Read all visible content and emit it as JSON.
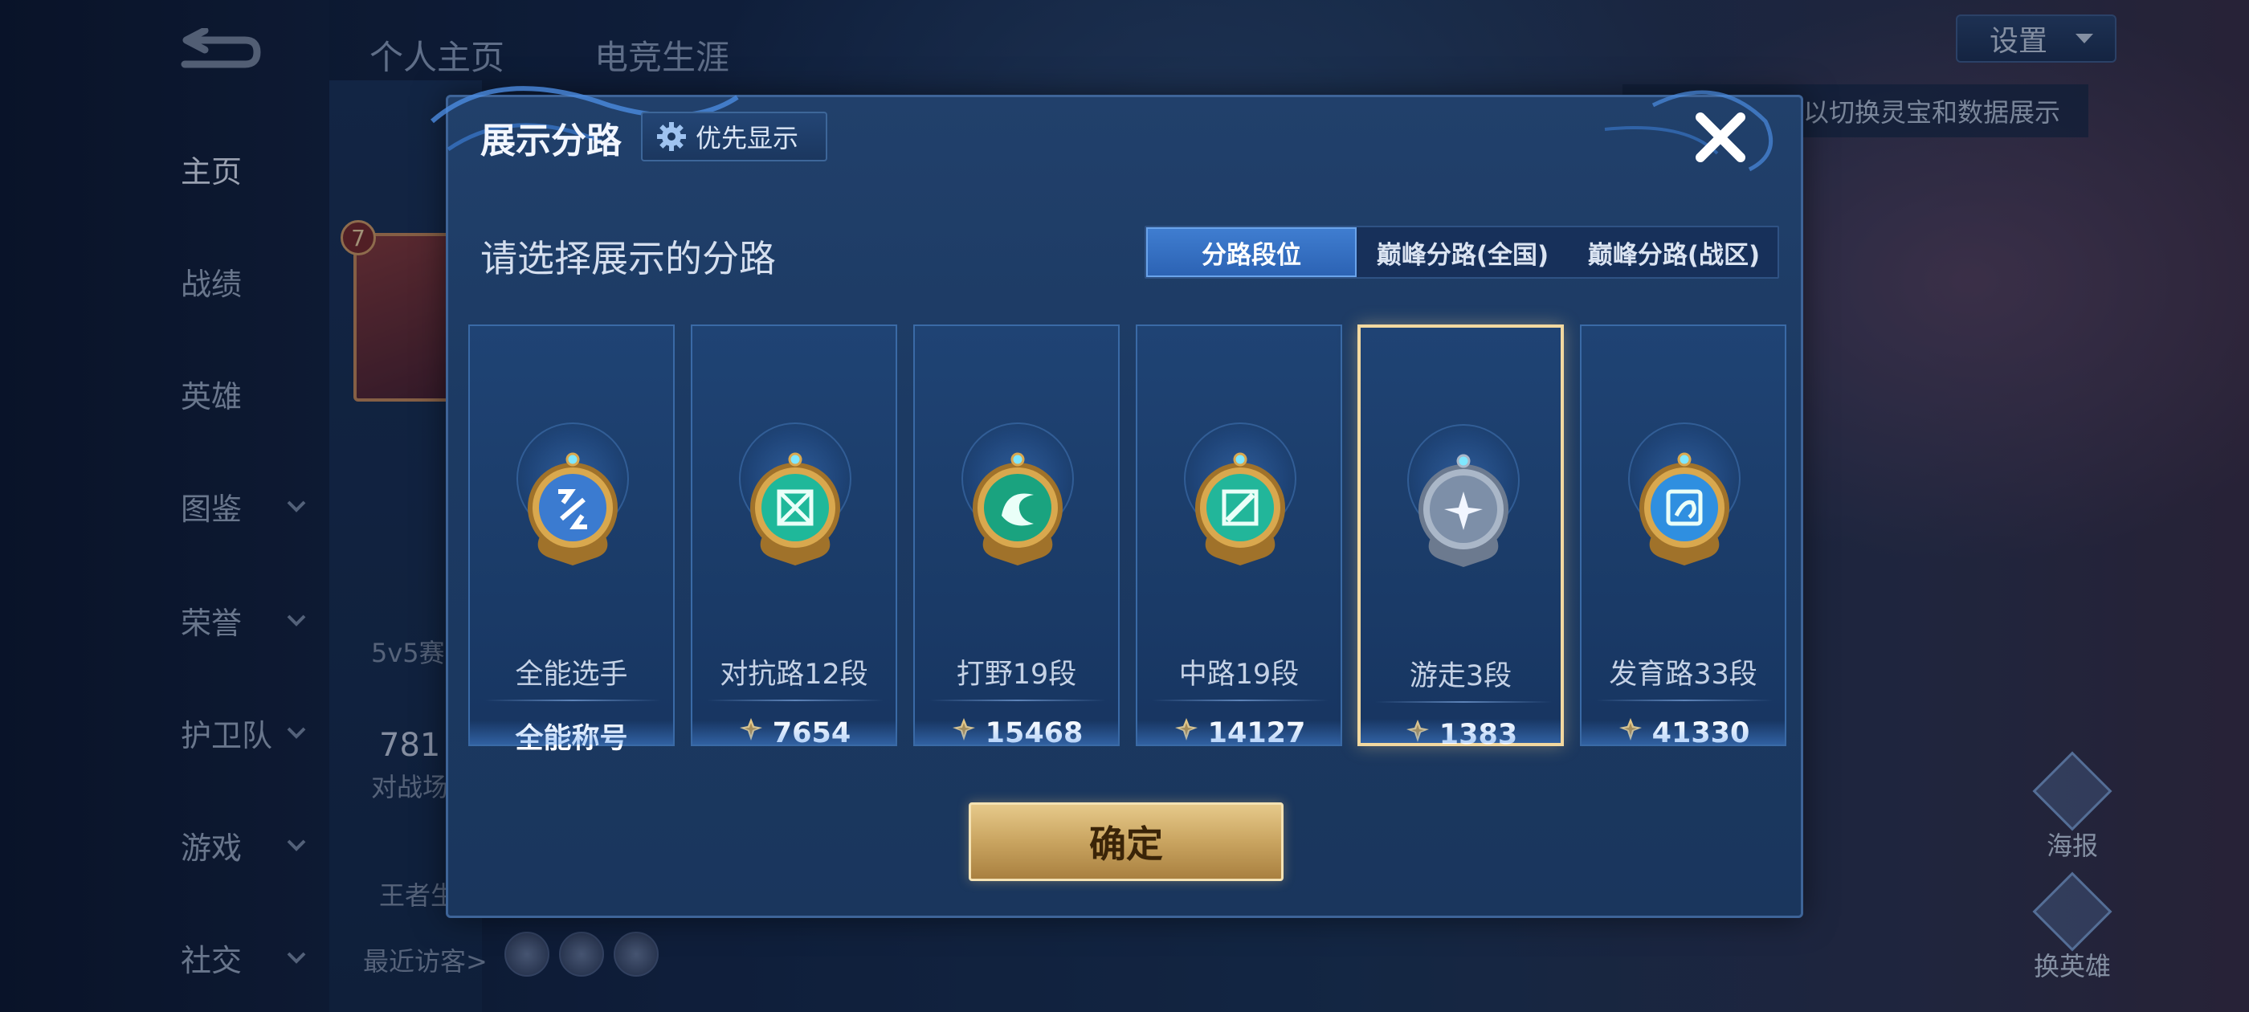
{
  "background": {
    "top_tabs": [
      "个人主页",
      "电竞生涯"
    ],
    "settings_label": "设置",
    "hint_text": "以切换灵宝和数据展示",
    "nav_items": [
      {
        "label": "主页",
        "active": true,
        "has_chevron": false
      },
      {
        "label": "战绩",
        "active": false,
        "has_chevron": false
      },
      {
        "label": "英雄",
        "active": false,
        "has_chevron": false
      },
      {
        "label": "图鉴",
        "active": false,
        "has_chevron": true
      },
      {
        "label": "荣誉",
        "active": false,
        "has_chevron": true
      },
      {
        "label": "护卫队",
        "active": false,
        "has_chevron": true
      },
      {
        "label": "游戏",
        "active": false,
        "has_chevron": true
      },
      {
        "label": "社交",
        "active": false,
        "has_chevron": true
      }
    ],
    "profile_level": "7",
    "mode_text": "5v5赛",
    "stat_number": "781",
    "stat_caption": "对战场",
    "king_text": "王者生",
    "recent_visitors_label": "最近访客>",
    "right_buttons": [
      "海报",
      "换英雄"
    ]
  },
  "modal": {
    "title": "展示分路",
    "priority_button_label": "优先显示",
    "subtitle": "请选择展示的分路",
    "tabs": [
      {
        "label": "分路段位",
        "active": true
      },
      {
        "label": "巅峰分路(全国)",
        "active": false
      },
      {
        "label": "巅峰分路(战区)",
        "active": false
      }
    ],
    "cards": [
      {
        "name": "全能选手",
        "score": "全能称号",
        "has_score_icon": false,
        "selected": false,
        "emblem_color": "#3b7bd0",
        "emblem": "all-round-emblem"
      },
      {
        "name": "对抗路12段",
        "score": "7654",
        "has_score_icon": true,
        "selected": false,
        "emblem_color": "#1fb89a",
        "emblem": "clash-lane-emblem"
      },
      {
        "name": "打野19段",
        "score": "15468",
        "has_score_icon": true,
        "selected": false,
        "emblem_color": "#1aa37f",
        "emblem": "jungle-emblem"
      },
      {
        "name": "中路19段",
        "score": "14127",
        "has_score_icon": true,
        "selected": false,
        "emblem_color": "#22b69a",
        "emblem": "mid-lane-emblem"
      },
      {
        "name": "游走3段",
        "score": "1383",
        "has_score_icon": true,
        "selected": true,
        "emblem_color": "#7d8fa8",
        "emblem": "roam-emblem"
      },
      {
        "name": "发育路33段",
        "score": "41330",
        "has_score_icon": true,
        "selected": false,
        "emblem_color": "#2f8fe0",
        "emblem": "farm-lane-emblem"
      }
    ],
    "confirm_label": "确定"
  },
  "colors": {
    "gold_accent": "#e6c98a",
    "selected_border": "#f3d9a0",
    "active_tab": "#3f7dd0"
  }
}
